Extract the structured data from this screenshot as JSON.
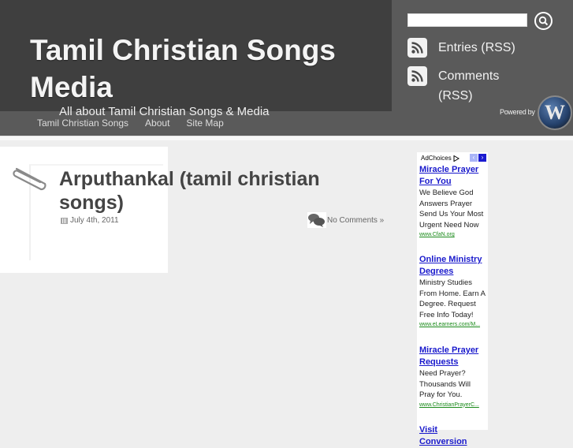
{
  "header": {
    "site_title": "Tamil Christian Songs Media",
    "tagline": "All about Tamil Christian Songs & Media",
    "nav": [
      {
        "label": "Tamil Christian Songs"
      },
      {
        "label": "About"
      },
      {
        "label": "Site Map"
      }
    ]
  },
  "sidebar": {
    "search": {
      "value": "",
      "placeholder": ""
    },
    "feeds": [
      {
        "label": "Entries (RSS)",
        "icon": "rss-icon"
      },
      {
        "label": "Comments (RSS)",
        "icon": "rss-icon"
      }
    ],
    "powered_by": "Powered by",
    "wp_logo_glyph": "W"
  },
  "post": {
    "title": "Arputhankal (tamil christian songs)",
    "date": "July 4th, 2011",
    "comments": "No Comments »"
  },
  "ads": {
    "adchoices": "AdChoices",
    "prev": "‹",
    "next": "›",
    "items": [
      {
        "title": "Miracle Prayer For You",
        "text": "We Believe God Answers Prayer Send Us Your Most Urgent Need Now",
        "url": "www.CfaN.org"
      },
      {
        "title": "Online Ministry Degrees",
        "text": "Ministry Studies From Home. Earn A Degree. Request Free Info Today!",
        "url": "www.eLearners.com/M..."
      },
      {
        "title": "Miracle Prayer Requests",
        "text": "Need Prayer? Thousands Will Pray for You.",
        "url": "www.ChristianPrayerC..."
      },
      {
        "title": "Visit Conversion",
        "text": "",
        "url": ""
      }
    ]
  },
  "colors": {
    "header_dark": "#3f3f3f",
    "header_mid": "#5a5a5a",
    "page_bg": "#eeeeee",
    "ad_link": "#1a1acc",
    "ad_url": "#1a8a1a"
  }
}
